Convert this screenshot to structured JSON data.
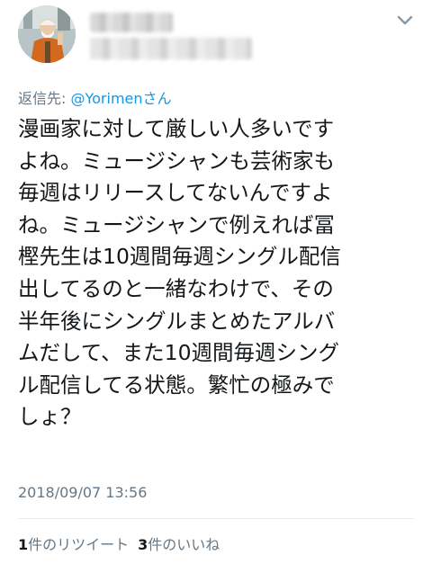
{
  "tweet": {
    "reply_label": "返信先: ",
    "reply_mention": "@Yorimen",
    "reply_suffix": "さん",
    "text_lines": [
      "漫画家に対して厳しい人多いです",
      "よね。ミュージシャンも芸術家も",
      "毎週はリリースしてないんですよ",
      "ね。ミュージシャンで例えれば冨",
      "樫先生は10週間毎週シングル配信",
      "出してるのと一緒なわけで、その",
      "半年後にシングルまとめたアルバ",
      "ムだして、また10週間毎週シング",
      "ル配信してる状態。繁忙の極みで",
      "しょ？"
    ],
    "timestamp": "2018/09/07 13:56"
  },
  "stats": {
    "retweets_count": "1",
    "retweets_label": "件のリツイート",
    "likes_count": "3",
    "likes_label": "件のいいね"
  },
  "icons": {
    "avatar": "avatar-photo",
    "menu": "chevron-down-icon"
  },
  "colors": {
    "text": "#14171a",
    "secondary": "#657786",
    "link": "#1b95e0",
    "divider": "#e6ecf0"
  }
}
